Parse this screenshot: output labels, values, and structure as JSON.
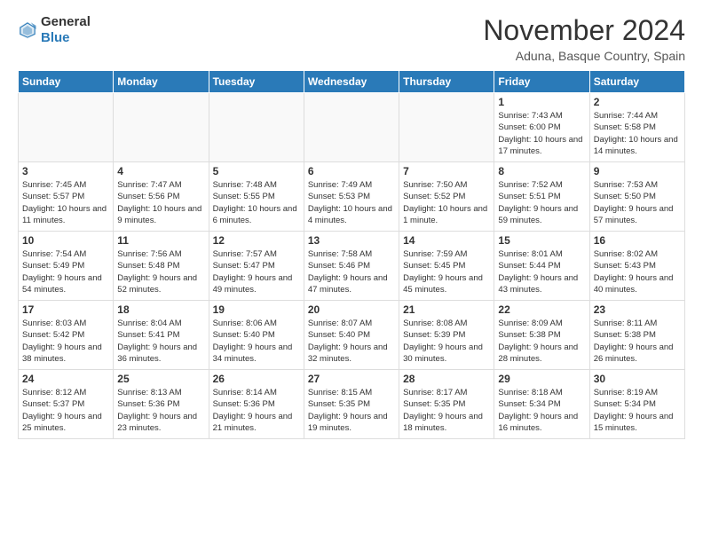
{
  "header": {
    "logo": {
      "general": "General",
      "blue": "Blue"
    },
    "title": "November 2024",
    "location": "Aduna, Basque Country, Spain"
  },
  "weekdays": [
    "Sunday",
    "Monday",
    "Tuesday",
    "Wednesday",
    "Thursday",
    "Friday",
    "Saturday"
  ],
  "weeks": [
    [
      {
        "day": "",
        "info": "",
        "empty": true
      },
      {
        "day": "",
        "info": "",
        "empty": true
      },
      {
        "day": "",
        "info": "",
        "empty": true
      },
      {
        "day": "",
        "info": "",
        "empty": true
      },
      {
        "day": "",
        "info": "",
        "empty": true
      },
      {
        "day": "1",
        "info": "Sunrise: 7:43 AM\nSunset: 6:00 PM\nDaylight: 10 hours and 17 minutes.",
        "empty": false
      },
      {
        "day": "2",
        "info": "Sunrise: 7:44 AM\nSunset: 5:58 PM\nDaylight: 10 hours and 14 minutes.",
        "empty": false
      }
    ],
    [
      {
        "day": "3",
        "info": "Sunrise: 7:45 AM\nSunset: 5:57 PM\nDaylight: 10 hours and 11 minutes.",
        "empty": false
      },
      {
        "day": "4",
        "info": "Sunrise: 7:47 AM\nSunset: 5:56 PM\nDaylight: 10 hours and 9 minutes.",
        "empty": false
      },
      {
        "day": "5",
        "info": "Sunrise: 7:48 AM\nSunset: 5:55 PM\nDaylight: 10 hours and 6 minutes.",
        "empty": false
      },
      {
        "day": "6",
        "info": "Sunrise: 7:49 AM\nSunset: 5:53 PM\nDaylight: 10 hours and 4 minutes.",
        "empty": false
      },
      {
        "day": "7",
        "info": "Sunrise: 7:50 AM\nSunset: 5:52 PM\nDaylight: 10 hours and 1 minute.",
        "empty": false
      },
      {
        "day": "8",
        "info": "Sunrise: 7:52 AM\nSunset: 5:51 PM\nDaylight: 9 hours and 59 minutes.",
        "empty": false
      },
      {
        "day": "9",
        "info": "Sunrise: 7:53 AM\nSunset: 5:50 PM\nDaylight: 9 hours and 57 minutes.",
        "empty": false
      }
    ],
    [
      {
        "day": "10",
        "info": "Sunrise: 7:54 AM\nSunset: 5:49 PM\nDaylight: 9 hours and 54 minutes.",
        "empty": false
      },
      {
        "day": "11",
        "info": "Sunrise: 7:56 AM\nSunset: 5:48 PM\nDaylight: 9 hours and 52 minutes.",
        "empty": false
      },
      {
        "day": "12",
        "info": "Sunrise: 7:57 AM\nSunset: 5:47 PM\nDaylight: 9 hours and 49 minutes.",
        "empty": false
      },
      {
        "day": "13",
        "info": "Sunrise: 7:58 AM\nSunset: 5:46 PM\nDaylight: 9 hours and 47 minutes.",
        "empty": false
      },
      {
        "day": "14",
        "info": "Sunrise: 7:59 AM\nSunset: 5:45 PM\nDaylight: 9 hours and 45 minutes.",
        "empty": false
      },
      {
        "day": "15",
        "info": "Sunrise: 8:01 AM\nSunset: 5:44 PM\nDaylight: 9 hours and 43 minutes.",
        "empty": false
      },
      {
        "day": "16",
        "info": "Sunrise: 8:02 AM\nSunset: 5:43 PM\nDaylight: 9 hours and 40 minutes.",
        "empty": false
      }
    ],
    [
      {
        "day": "17",
        "info": "Sunrise: 8:03 AM\nSunset: 5:42 PM\nDaylight: 9 hours and 38 minutes.",
        "empty": false
      },
      {
        "day": "18",
        "info": "Sunrise: 8:04 AM\nSunset: 5:41 PM\nDaylight: 9 hours and 36 minutes.",
        "empty": false
      },
      {
        "day": "19",
        "info": "Sunrise: 8:06 AM\nSunset: 5:40 PM\nDaylight: 9 hours and 34 minutes.",
        "empty": false
      },
      {
        "day": "20",
        "info": "Sunrise: 8:07 AM\nSunset: 5:40 PM\nDaylight: 9 hours and 32 minutes.",
        "empty": false
      },
      {
        "day": "21",
        "info": "Sunrise: 8:08 AM\nSunset: 5:39 PM\nDaylight: 9 hours and 30 minutes.",
        "empty": false
      },
      {
        "day": "22",
        "info": "Sunrise: 8:09 AM\nSunset: 5:38 PM\nDaylight: 9 hours and 28 minutes.",
        "empty": false
      },
      {
        "day": "23",
        "info": "Sunrise: 8:11 AM\nSunset: 5:38 PM\nDaylight: 9 hours and 26 minutes.",
        "empty": false
      }
    ],
    [
      {
        "day": "24",
        "info": "Sunrise: 8:12 AM\nSunset: 5:37 PM\nDaylight: 9 hours and 25 minutes.",
        "empty": false
      },
      {
        "day": "25",
        "info": "Sunrise: 8:13 AM\nSunset: 5:36 PM\nDaylight: 9 hours and 23 minutes.",
        "empty": false
      },
      {
        "day": "26",
        "info": "Sunrise: 8:14 AM\nSunset: 5:36 PM\nDaylight: 9 hours and 21 minutes.",
        "empty": false
      },
      {
        "day": "27",
        "info": "Sunrise: 8:15 AM\nSunset: 5:35 PM\nDaylight: 9 hours and 19 minutes.",
        "empty": false
      },
      {
        "day": "28",
        "info": "Sunrise: 8:17 AM\nSunset: 5:35 PM\nDaylight: 9 hours and 18 minutes.",
        "empty": false
      },
      {
        "day": "29",
        "info": "Sunrise: 8:18 AM\nSunset: 5:34 PM\nDaylight: 9 hours and 16 minutes.",
        "empty": false
      },
      {
        "day": "30",
        "info": "Sunrise: 8:19 AM\nSunset: 5:34 PM\nDaylight: 9 hours and 15 minutes.",
        "empty": false
      }
    ]
  ]
}
